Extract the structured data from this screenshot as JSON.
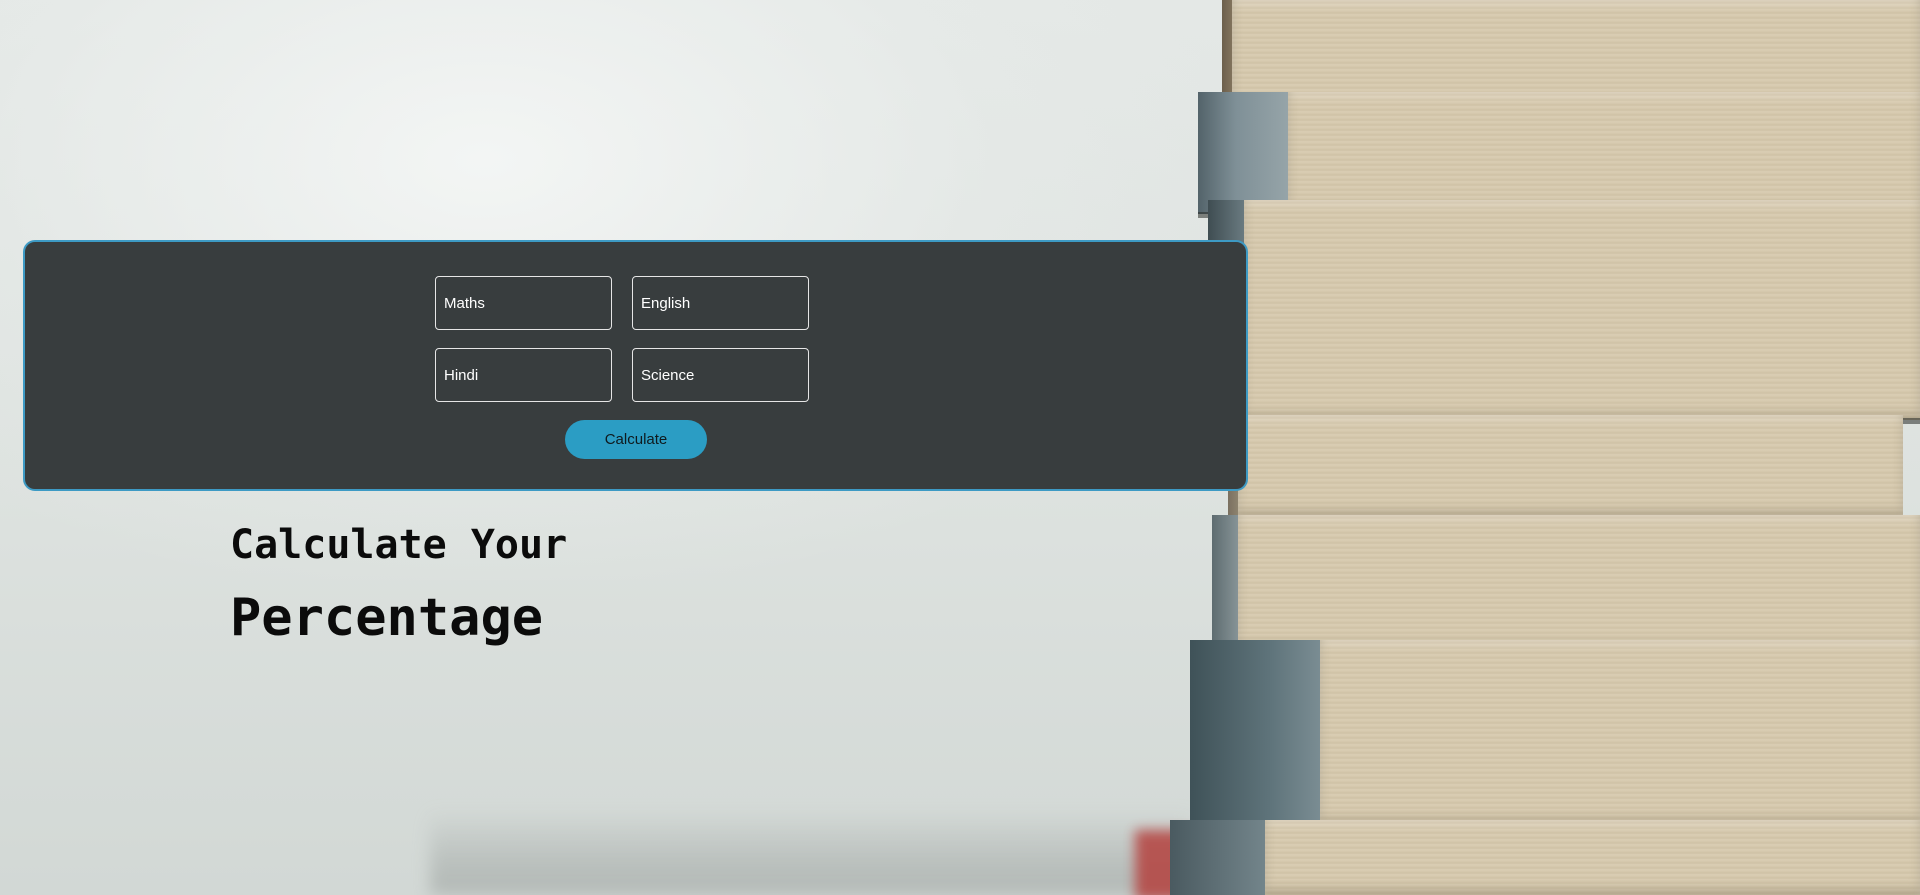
{
  "form": {
    "fields": [
      {
        "name": "maths",
        "placeholder": "Maths"
      },
      {
        "name": "english",
        "placeholder": "English"
      },
      {
        "name": "hindi",
        "placeholder": "Hindi"
      },
      {
        "name": "science",
        "placeholder": "Science"
      }
    ],
    "button_label": "Calculate"
  },
  "heading": {
    "line1": "Calculate Your",
    "line2": "Percentage"
  },
  "colors": {
    "card_background": "#383d3e",
    "card_border": "#3d9ac4",
    "button": "#2b9dc4",
    "field_border": "#e6e6e6"
  },
  "background": {
    "image": "book-stack-photo"
  }
}
